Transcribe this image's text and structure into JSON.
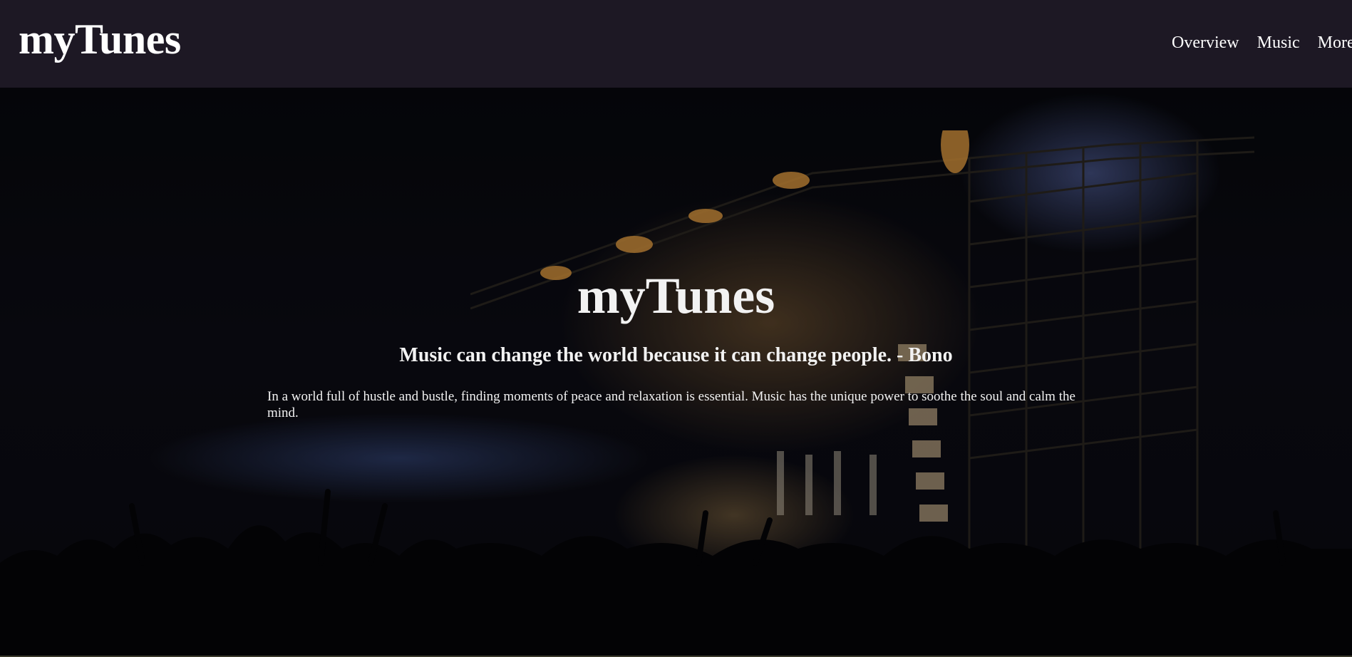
{
  "header": {
    "brand": "myTunes",
    "nav": [
      {
        "label": "Overview"
      },
      {
        "label": "Music"
      },
      {
        "label": "More"
      }
    ]
  },
  "hero": {
    "title": "myTunes",
    "quote": "Music can change the world because it can change people. - Bono",
    "paragraph": "In a world full of hustle and bustle, finding moments of peace and relaxation is essential. Music has the unique power to soothe the soul and calm the mind."
  },
  "colors": {
    "navbar_bg": "#1d1824",
    "text": "#ffffff"
  }
}
